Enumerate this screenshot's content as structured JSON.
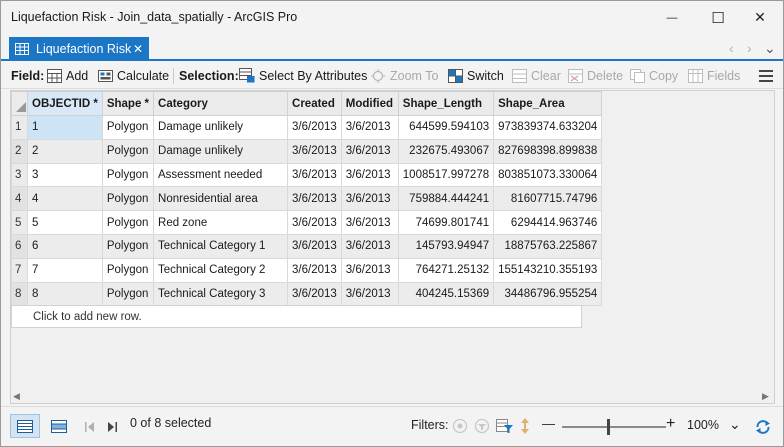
{
  "window": {
    "title": "Liquefaction Risk - Join_data_spatially - ArcGIS Pro",
    "minimize_glyph": "—",
    "maximize_glyph": "☐",
    "close_glyph": "✕"
  },
  "tab": {
    "label": "Liquefaction Risk",
    "icon": "table-icon",
    "close_glyph": "✕",
    "nav_prev": "‹",
    "nav_next": "›",
    "nav_menu": "⌄"
  },
  "toolbar": {
    "field_label": "Field:",
    "add_label": "Add",
    "calculate_label": "Calculate",
    "selection_label": "Selection:",
    "select_by_attributes_label": "Select By Attributes",
    "zoom_to_label": "Zoom To",
    "switch_label": "Switch",
    "clear_label": "Clear",
    "delete_label": "Delete",
    "copy_label": "Copy",
    "fields_label": "Fields"
  },
  "table": {
    "columns": [
      "OBJECTID *",
      "Shape *",
      "Category",
      "Created",
      "Modified",
      "Shape_Length",
      "Shape_Area"
    ],
    "rows": [
      {
        "rownum": "1",
        "objectid": "1",
        "shape": "Polygon",
        "category": "Damage unlikely",
        "created": "3/6/2013",
        "modified": "3/6/2013",
        "length": "644599.594103",
        "area": "973839374.633204"
      },
      {
        "rownum": "2",
        "objectid": "2",
        "shape": "Polygon",
        "category": "Damage unlikely",
        "created": "3/6/2013",
        "modified": "3/6/2013",
        "length": "232675.493067",
        "area": "827698398.899838"
      },
      {
        "rownum": "3",
        "objectid": "3",
        "shape": "Polygon",
        "category": "Assessment needed",
        "created": "3/6/2013",
        "modified": "3/6/2013",
        "length": "1008517.997278",
        "area": "803851073.330064"
      },
      {
        "rownum": "4",
        "objectid": "4",
        "shape": "Polygon",
        "category": "Nonresidential area",
        "created": "3/6/2013",
        "modified": "3/6/2013",
        "length": "759884.444241",
        "area": "81607715.74796"
      },
      {
        "rownum": "5",
        "objectid": "5",
        "shape": "Polygon",
        "category": "Red zone",
        "created": "3/6/2013",
        "modified": "3/6/2013",
        "length": "74699.801741",
        "area": "6294414.963746"
      },
      {
        "rownum": "6",
        "objectid": "6",
        "shape": "Polygon",
        "category": "Technical Category 1",
        "created": "3/6/2013",
        "modified": "3/6/2013",
        "length": "145793.94947",
        "area": "18875763.225867"
      },
      {
        "rownum": "7",
        "objectid": "7",
        "shape": "Polygon",
        "category": "Technical Category 2",
        "created": "3/6/2013",
        "modified": "3/6/2013",
        "length": "764271.25132",
        "area": "155143210.355193"
      },
      {
        "rownum": "8",
        "objectid": "8",
        "shape": "Polygon",
        "category": "Technical Category 3",
        "created": "3/6/2013",
        "modified": "3/6/2013",
        "length": "404245.15369",
        "area": "34486796.955254"
      }
    ],
    "add_row_text": "Click to add new row."
  },
  "status": {
    "selected_text": "0 of 8 selected",
    "filters_label": "Filters:",
    "zoom_minus": "—",
    "zoom_plus": "+",
    "zoom_level": "100%",
    "zoom_menu": "⌄"
  },
  "colors": {
    "accent": "#1c76c6",
    "selected_cell": "#cde4f7"
  }
}
